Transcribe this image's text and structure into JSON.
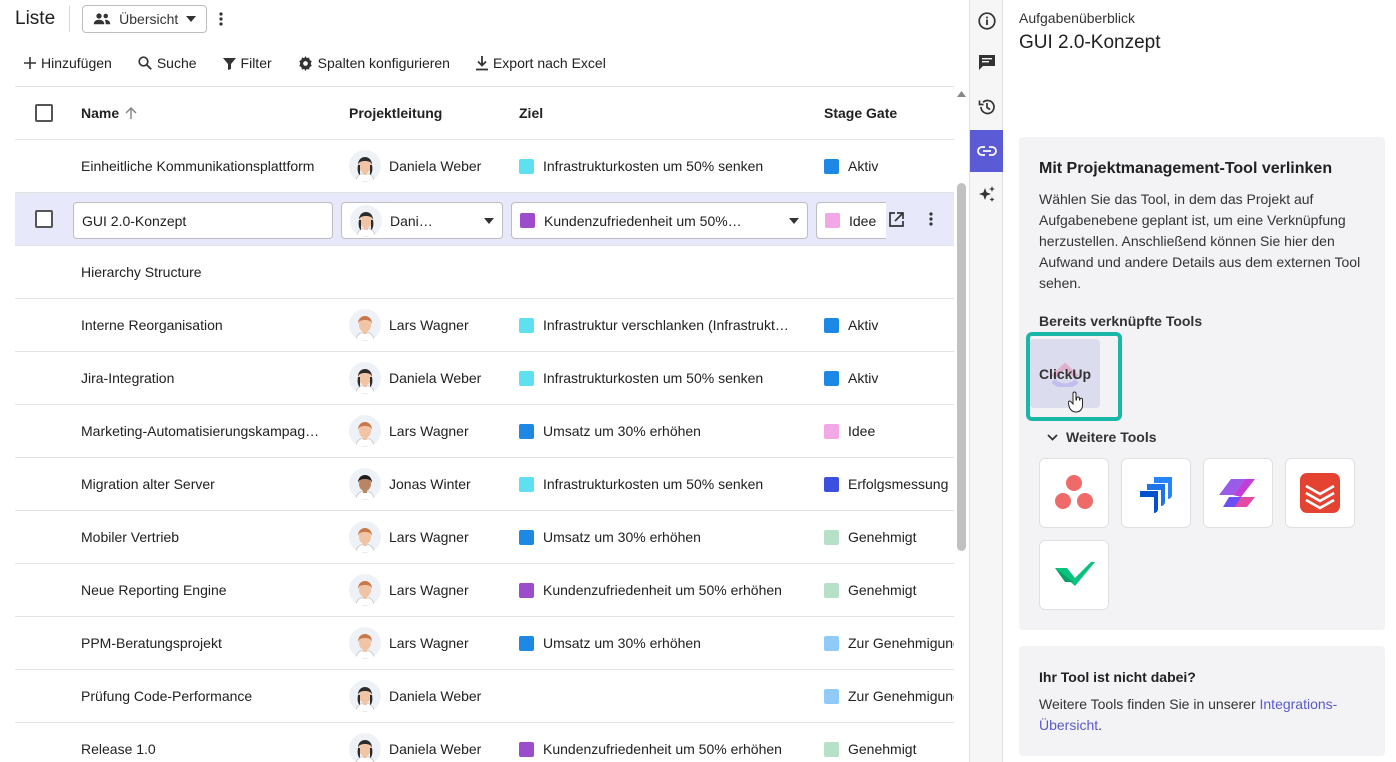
{
  "list": {
    "title": "Liste",
    "view_select": "Übersicht",
    "toolbar": {
      "add": "Hinzufügen",
      "search": "Suche",
      "filter": "Filter",
      "columns": "Spalten konfigurieren",
      "export": "Export nach Excel"
    },
    "columns": {
      "name": "Name",
      "lead": "Projektleitung",
      "goal": "Ziel",
      "gate": "Stage Gate"
    },
    "rows": [
      {
        "name": "Einheitliche Kommunikationsplattform",
        "lead": "Daniela Weber",
        "avatar": "female",
        "goal": "Infrastrukturkosten um 50% senken",
        "goal_color": "#5fe0f0",
        "gate": "Aktiv",
        "gate_color": "#1e88e5"
      },
      {
        "name": "GUI 2.0-Konzept",
        "lead": "Dani…",
        "avatar": "female",
        "goal": "Kundenzufriedenheit um 50%…",
        "goal_color": "#9c4dcc",
        "gate": "Idee",
        "gate_color": "#f2a8e6",
        "selected": true
      },
      {
        "name": "Hierarchy Structure",
        "lead": "",
        "avatar": "",
        "goal": "",
        "goal_color": "",
        "gate": "",
        "gate_color": ""
      },
      {
        "name": "Interne Reorganisation",
        "lead": "Lars Wagner",
        "avatar": "male",
        "goal": "Infrastruktur verschlanken (Infrastrukt…",
        "goal_color": "#5fe0f0",
        "gate": "Aktiv",
        "gate_color": "#1e88e5"
      },
      {
        "name": "Jira-Integration",
        "lead": "Daniela Weber",
        "avatar": "female",
        "goal": "Infrastrukturkosten um 50% senken",
        "goal_color": "#5fe0f0",
        "gate": "Aktiv",
        "gate_color": "#1e88e5"
      },
      {
        "name": "Marketing-Automatisierungskampag…",
        "lead": "Lars Wagner",
        "avatar": "male",
        "goal": "Umsatz um 30% erhöhen",
        "goal_color": "#1e88e5",
        "gate": "Idee",
        "gate_color": "#f2a8e6"
      },
      {
        "name": "Migration alter Server",
        "lead": "Jonas Winter",
        "avatar": "male2",
        "goal": "Infrastrukturkosten um 50% senken",
        "goal_color": "#5fe0f0",
        "gate": "Erfolgsmessung",
        "gate_color": "#3b4fe0"
      },
      {
        "name": "Mobiler Vertrieb",
        "lead": "Lars Wagner",
        "avatar": "male",
        "goal": "Umsatz um 30% erhöhen",
        "goal_color": "#1e88e5",
        "gate": "Genehmigt",
        "gate_color": "#b6e0c8"
      },
      {
        "name": "Neue Reporting Engine",
        "lead": "Lars Wagner",
        "avatar": "male",
        "goal": "Kundenzufriedenheit um 50% erhöhen",
        "goal_color": "#9c4dcc",
        "gate": "Genehmigt",
        "gate_color": "#b6e0c8"
      },
      {
        "name": "PPM-Beratungsprojekt",
        "lead": "Lars Wagner",
        "avatar": "male",
        "goal": "Umsatz um 30% erhöhen",
        "goal_color": "#1e88e5",
        "gate": "Zur Genehmigung",
        "gate_color": "#90caf9"
      },
      {
        "name": "Prüfung Code-Performance",
        "lead": "Daniela Weber",
        "avatar": "female",
        "goal": "",
        "goal_color": "",
        "gate": "Zur Genehmigung",
        "gate_color": "#90caf9"
      },
      {
        "name": "Release 1.0",
        "lead": "Daniela Weber",
        "avatar": "female",
        "goal": "Kundenzufriedenheit um 50% erhöhen",
        "goal_color": "#9c4dcc",
        "gate": "Genehmigt",
        "gate_color": "#b6e0c8"
      }
    ]
  },
  "rail": [
    "info-icon",
    "chat-icon",
    "history-icon",
    "link-icon",
    "sparkle-icon"
  ],
  "panel": {
    "subtitle": "Aufgabenüberblick",
    "title": "GUI 2.0-Konzept",
    "card": {
      "heading": "Mit Projektmanagement-Tool verlinken",
      "description": "Wählen Sie das Tool, in dem das Projekt auf Aufgabenebene geplant ist, um eine Verknüpfung herzustellen. Anschließend können Sie hier den Aufwand und andere Details aus dem externen Tool sehen.",
      "linked_label": "Bereits verknüpfte Tools",
      "linked_tool": "ClickUp",
      "more_label": "Weitere Tools",
      "more_tools": [
        "asana-icon",
        "jira-icon",
        "ms-planner-icon",
        "todoist-icon",
        "wrike-icon"
      ]
    },
    "footer": {
      "heading": "Ihr Tool ist nicht dabei?",
      "text": "Weitere Tools finden Sie in unserer ",
      "link": "Integrations-Übersicht",
      "end": "."
    }
  },
  "colors": {
    "accent": "#5b5bd6",
    "highlight": "#18b7a8",
    "selected_row": "#e8e8fb"
  }
}
